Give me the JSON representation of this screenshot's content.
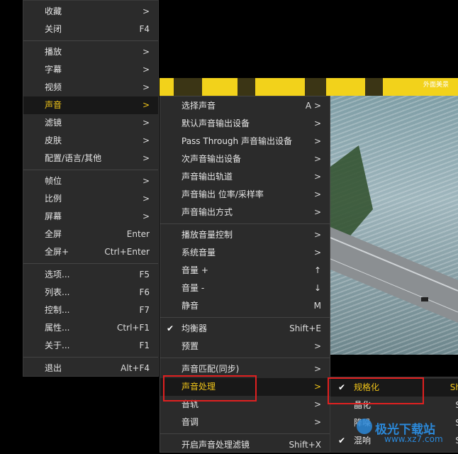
{
  "main_menu": {
    "sections": [
      [
        {
          "label": "收藏",
          "shortcut": ">"
        },
        {
          "label": "关闭",
          "shortcut": "F4"
        }
      ],
      [
        {
          "label": "播放",
          "shortcut": ">"
        },
        {
          "label": "字幕",
          "shortcut": ">"
        },
        {
          "label": "视频",
          "shortcut": ">"
        },
        {
          "label": "声音",
          "shortcut": ">",
          "active": true
        },
        {
          "label": "滤镜",
          "shortcut": ">"
        },
        {
          "label": "皮肤",
          "shortcut": ">"
        },
        {
          "label": "配置/语言/其他",
          "shortcut": ">"
        }
      ],
      [
        {
          "label": "帧位",
          "shortcut": ">"
        },
        {
          "label": "比例",
          "shortcut": ">"
        },
        {
          "label": "屏幕",
          "shortcut": ">"
        },
        {
          "label": "全屏",
          "shortcut": "Enter"
        },
        {
          "label": "全屏+",
          "shortcut": "Ctrl+Enter"
        }
      ],
      [
        {
          "label": "选项...",
          "shortcut": "F5"
        },
        {
          "label": "列表...",
          "shortcut": "F6"
        },
        {
          "label": "控制...",
          "shortcut": "F7"
        },
        {
          "label": "属性...",
          "shortcut": "Ctrl+F1"
        },
        {
          "label": "关于...",
          "shortcut": "F1"
        }
      ],
      [
        {
          "label": "退出",
          "shortcut": "Alt+F4"
        }
      ]
    ]
  },
  "audio_menu": {
    "sections": [
      [
        {
          "label": "选择声音",
          "shortcut": "A >"
        },
        {
          "label": "默认声音输出设备",
          "shortcut": ">"
        },
        {
          "label": "Pass Through 声音输出设备",
          "shortcut": ">"
        },
        {
          "label": "次声音输出设备",
          "shortcut": ">"
        },
        {
          "label": "声音输出轨道",
          "shortcut": ">"
        },
        {
          "label": "声音输出 位率/采样率",
          "shortcut": ">"
        },
        {
          "label": "声音输出方式",
          "shortcut": ">"
        }
      ],
      [
        {
          "label": "播放音量控制",
          "shortcut": ">"
        },
        {
          "label": "系统音量",
          "shortcut": ">"
        },
        {
          "label": "音量 +",
          "shortcut": "↑"
        },
        {
          "label": "音量 -",
          "shortcut": "↓"
        },
        {
          "label": "静音",
          "shortcut": "M"
        }
      ],
      [
        {
          "label": "均衡器",
          "shortcut": "Shift+E",
          "checked": true
        },
        {
          "label": "预置",
          "shortcut": ">"
        }
      ],
      [
        {
          "label": "声音匹配(同步)",
          "shortcut": ">"
        },
        {
          "label": "声音处理",
          "shortcut": ">",
          "active": true
        },
        {
          "label": "音轨",
          "shortcut": ">"
        },
        {
          "label": "音调",
          "shortcut": ">"
        }
      ],
      [
        {
          "label": "开启声音处理滤镜",
          "shortcut": "Shift+X"
        }
      ]
    ]
  },
  "processing_menu": {
    "items": [
      {
        "label": "规格化",
        "shortcut": "Sh",
        "checked": true,
        "active": true
      },
      {
        "label": "晶化",
        "shortcut": "S"
      },
      {
        "label": "降噪",
        "shortcut": "S"
      },
      {
        "label": "混响",
        "shortcut": "S",
        "checked": true
      }
    ]
  },
  "video": {
    "watermark": "外面美景"
  },
  "logo": {
    "name": "极光下载站",
    "url": "www.xz7.com"
  },
  "colors": {
    "menu_bg": "#2b2b2b",
    "active_text": "#f0c419",
    "highlight_box": "#e02020",
    "logo": "#2b88d8"
  }
}
